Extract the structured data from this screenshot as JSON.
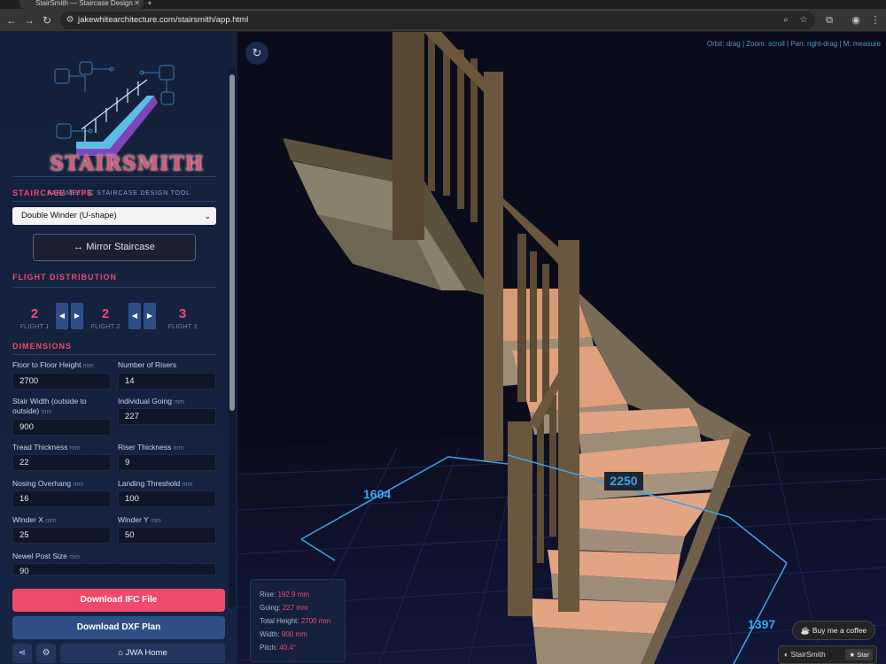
{
  "browser": {
    "tab_title": "StairSmith — Staircase Design",
    "url": "jakewhitearchitecture.com/stairsmith/app.html"
  },
  "sidebar": {
    "logo_word": "STAIRSMITH",
    "tagline": "PARAMETRIC STAIRCASE DESIGN TOOL",
    "staircase_type": {
      "title": "STAIRCASE TYPE",
      "selected": "Double Winder (U-shape)",
      "mirror_label": "↔ Mirror Staircase"
    },
    "flight_distribution": {
      "title": "FLIGHT DISTRIBUTION",
      "flights": [
        {
          "value": "2",
          "label": "FLIGHT 1"
        },
        {
          "value": "2",
          "label": "FLIGHT 2"
        },
        {
          "value": "3",
          "label": "FLIGHT 3"
        }
      ]
    },
    "dimensions": {
      "title": "DIMENSIONS",
      "fields": [
        {
          "label": "Floor to Floor Height",
          "unit": "mm",
          "value": "2700"
        },
        {
          "label": "Number of Risers",
          "unit": "",
          "value": "14"
        },
        {
          "label": "Stair Width (outside to outside)",
          "unit": "mm",
          "value": "900"
        },
        {
          "label": "Individual Going",
          "unit": "mm",
          "value": "227"
        },
        {
          "label": "Tread Thickness",
          "unit": "mm",
          "value": "22"
        },
        {
          "label": "Riser Thickness",
          "unit": "mm",
          "value": "9"
        },
        {
          "label": "Nosing Overhang",
          "unit": "mm",
          "value": "16"
        },
        {
          "label": "Landing Threshold",
          "unit": "mm",
          "value": "100"
        },
        {
          "label": "Winder X",
          "unit": "mm",
          "value": "25"
        },
        {
          "label": "Winder Y",
          "unit": "mm",
          "value": "50"
        },
        {
          "label": "Newel Post Size",
          "unit": "mm",
          "value": "90"
        }
      ]
    },
    "buttons": {
      "ifc": "Download IFC File",
      "dxf": "Download DXF Plan",
      "home": "⌂ JWA Home"
    }
  },
  "viewport": {
    "controls_hint": "Orbit: drag | Zoom: scroll | Pan: right-drag | M: measure",
    "dimensions": {
      "left": "1604",
      "center": "2250",
      "right": "1397"
    },
    "info": [
      {
        "label": "Rise:",
        "value": "192.9 mm"
      },
      {
        "label": "Going:",
        "value": "227 mm"
      },
      {
        "label": "Total Height:",
        "value": "2700 mm"
      },
      {
        "label": "Width:",
        "value": "900 mm"
      },
      {
        "label": "Pitch:",
        "value": "40.4°"
      }
    ],
    "coffee_label": "☕ Buy me a coffee",
    "github_label": "StairSmith",
    "star_label": "★ Star"
  }
}
